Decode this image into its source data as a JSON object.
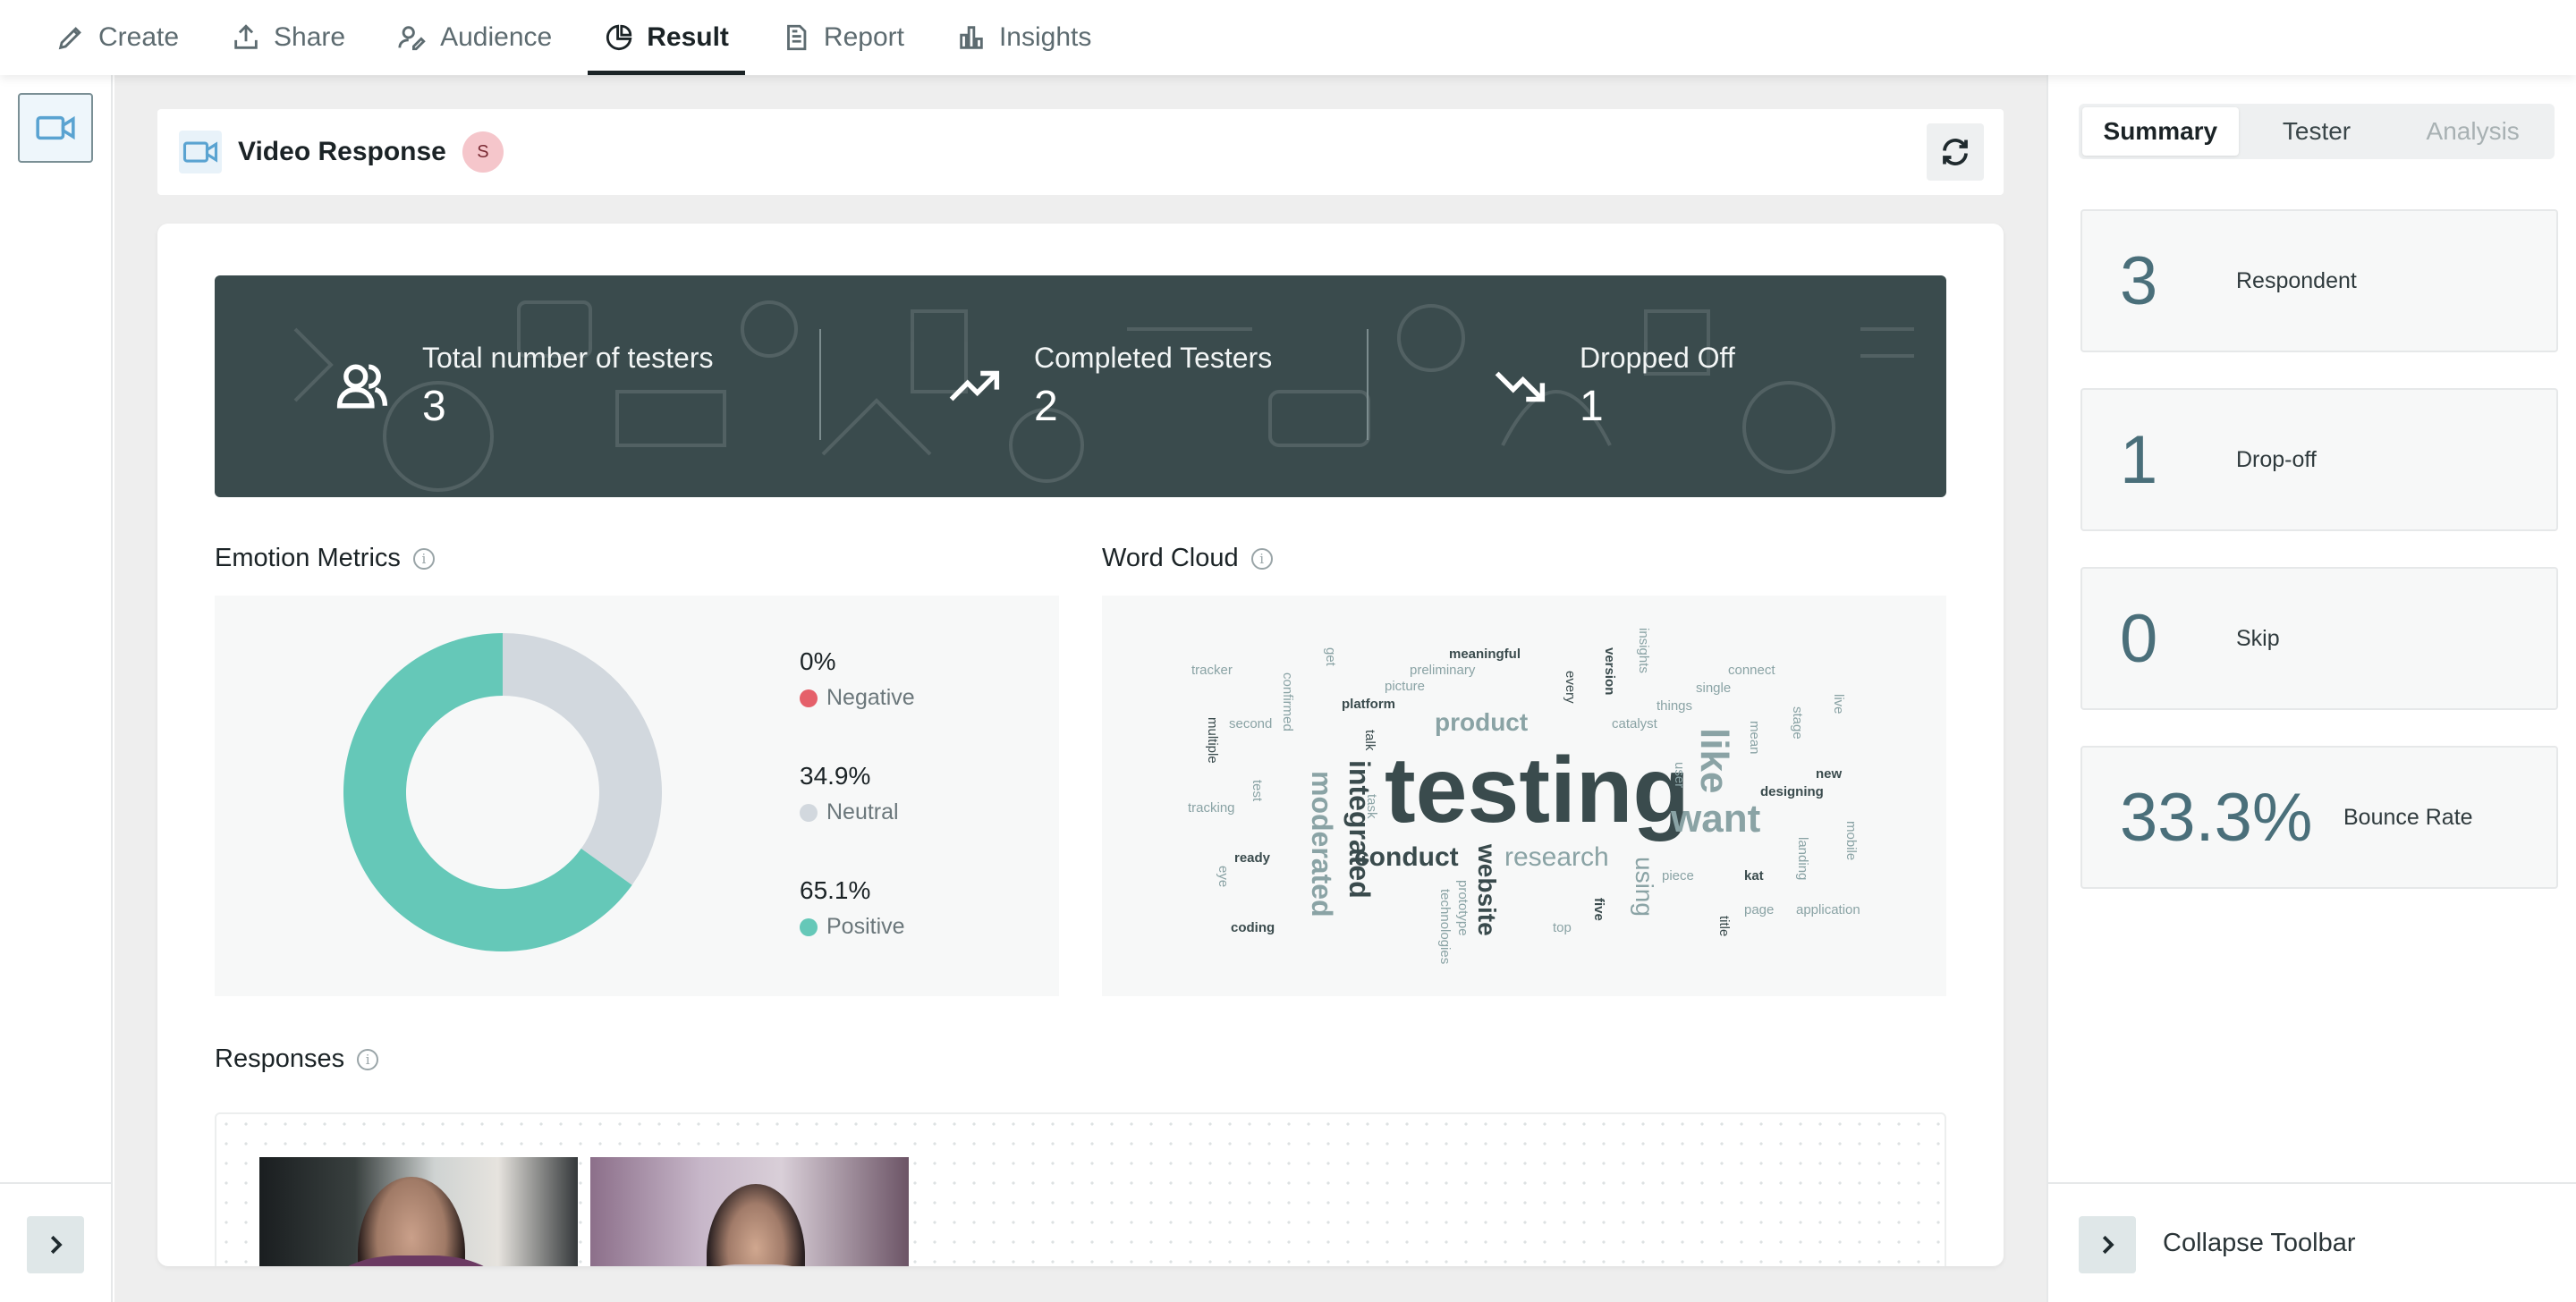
{
  "nav": {
    "tabs": [
      {
        "label": "Create",
        "icon": "pencil-icon"
      },
      {
        "label": "Share",
        "icon": "share-icon"
      },
      {
        "label": "Audience",
        "icon": "audience-icon"
      },
      {
        "label": "Result",
        "icon": "pie-chart-icon",
        "active": true
      },
      {
        "label": "Report",
        "icon": "document-icon"
      },
      {
        "label": "Insights",
        "icon": "bar-chart-icon"
      }
    ]
  },
  "header": {
    "title": "Video Response",
    "badge": "S"
  },
  "stats": {
    "total_label": "Total number of testers",
    "total_value": "3",
    "completed_label": "Completed Testers",
    "completed_value": "2",
    "dropped_label": "Dropped Off",
    "dropped_value": "1"
  },
  "emotion": {
    "title": "Emotion Metrics",
    "items": [
      {
        "pct": "0%",
        "name": "Negative",
        "color": "#e5606a"
      },
      {
        "pct": "34.9%",
        "name": "Neutral",
        "color": "#d2d8de"
      },
      {
        "pct": "65.1%",
        "name": "Positive",
        "color": "#65c8b8"
      }
    ]
  },
  "chart_data": {
    "type": "pie",
    "categories": [
      "Negative",
      "Neutral",
      "Positive"
    ],
    "values": [
      0,
      34.9,
      65.1
    ]
  },
  "wordcloud": {
    "title": "Word Cloud",
    "words": [
      "testing",
      "like",
      "want",
      "product",
      "research",
      "conduct",
      "integrated",
      "moderated",
      "website",
      "using",
      "tracker",
      "get",
      "meaningful",
      "preliminary",
      "picture",
      "confirmed",
      "platform",
      "every",
      "version",
      "insights",
      "connect",
      "single",
      "things",
      "catalyst",
      "live",
      "stage",
      "mean",
      "second",
      "multiple",
      "talk",
      "user",
      "new",
      "designing",
      "tracking",
      "test",
      "task",
      "mobile",
      "landing",
      "ready",
      "eye",
      "piece",
      "kat",
      "technologies",
      "prototype",
      "five",
      "top",
      "coding",
      "title",
      "page",
      "application"
    ]
  },
  "responses": {
    "title": "Responses"
  },
  "summary": {
    "tabs": [
      "Summary",
      "Tester",
      "Analysis"
    ],
    "metrics": [
      {
        "value": "3",
        "label": "Respondent"
      },
      {
        "value": "1",
        "label": "Drop-off"
      },
      {
        "value": "0",
        "label": "Skip"
      },
      {
        "value": "33.3%",
        "label": "Bounce Rate"
      }
    ],
    "collapse_label": "Collapse Toolbar"
  }
}
